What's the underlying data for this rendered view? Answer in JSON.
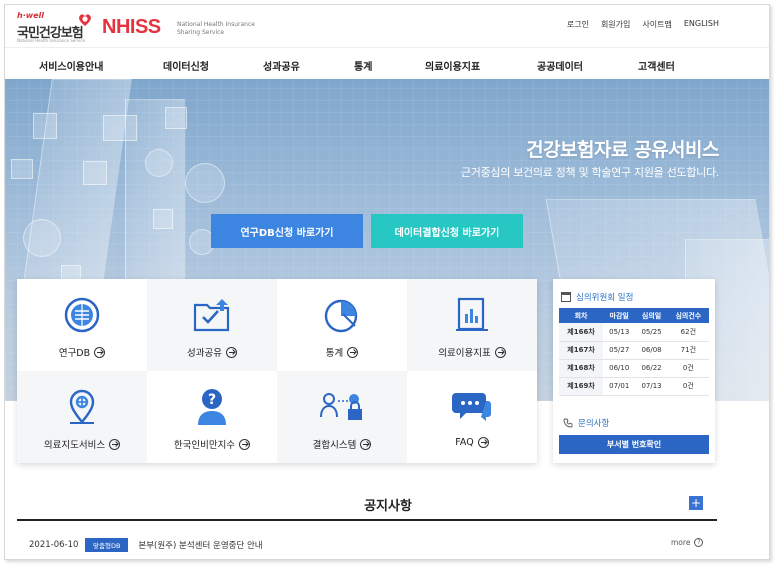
{
  "brand": {
    "hwell": "h·well",
    "name_ko": "국민건강보험",
    "name_sub": "National Health Insurance Service",
    "system": "NHISS",
    "system_desc_1": "National Health Insurance",
    "system_desc_2": "Sharing Service"
  },
  "utils": [
    "로그인",
    "회원가입",
    "사이트맵",
    "ENGLISH"
  ],
  "gnb": [
    "서비스이용안내",
    "데이터신청",
    "성과공유",
    "통계",
    "의료이용지표",
    "공공데이터",
    "고객센터"
  ],
  "hero": {
    "title": "건강보험자료 공유서비스",
    "subtitle": "근거중심의 보건의료 정책 및 학술연구 지원을 선도합니다.",
    "btn_db": "연구DB신청 바로가기",
    "btn_join": "데이터결합신청 바로가기"
  },
  "services": [
    {
      "label": "연구DB",
      "icon": "database-globe-icon"
    },
    {
      "label": "성과공유",
      "icon": "folder-share-icon"
    },
    {
      "label": "통계",
      "icon": "pie-chart-icon"
    },
    {
      "label": "의료이용지표",
      "icon": "report-chart-icon"
    },
    {
      "label": "의료지도서비스",
      "icon": "map-pin-icon"
    },
    {
      "label": "한국인비만지수",
      "icon": "person-question-icon"
    },
    {
      "label": "결합시스템",
      "icon": "users-lock-icon"
    },
    {
      "label": "FAQ",
      "icon": "chat-bubbles-icon"
    }
  ],
  "committee": {
    "title": "심의위원회 일정",
    "columns": [
      "회차",
      "마감일",
      "심의일",
      "심의건수"
    ],
    "rows": [
      [
        "제166차",
        "05/13",
        "05/25",
        "62건"
      ],
      [
        "제167차",
        "05/27",
        "06/08",
        "71건"
      ],
      [
        "제168차",
        "06/10",
        "06/22",
        "0건"
      ],
      [
        "제169차",
        "07/01",
        "07/13",
        "0건"
      ]
    ],
    "inquiry": "문의사항",
    "dept_btn": "부서별 번호확인"
  },
  "notice": {
    "title": "공지사항",
    "plus": "+",
    "items": [
      {
        "date": "2021-06-10",
        "tag": "맞춤형DB",
        "title": "본부(원주) 분석센터 운영중단 안내"
      }
    ],
    "more": "more",
    "more_icon": "?"
  },
  "colors": {
    "brand_red": "#e5343f",
    "primary_blue": "#3c86e2",
    "teal": "#27c8c4",
    "table_blue": "#2c66c4"
  }
}
